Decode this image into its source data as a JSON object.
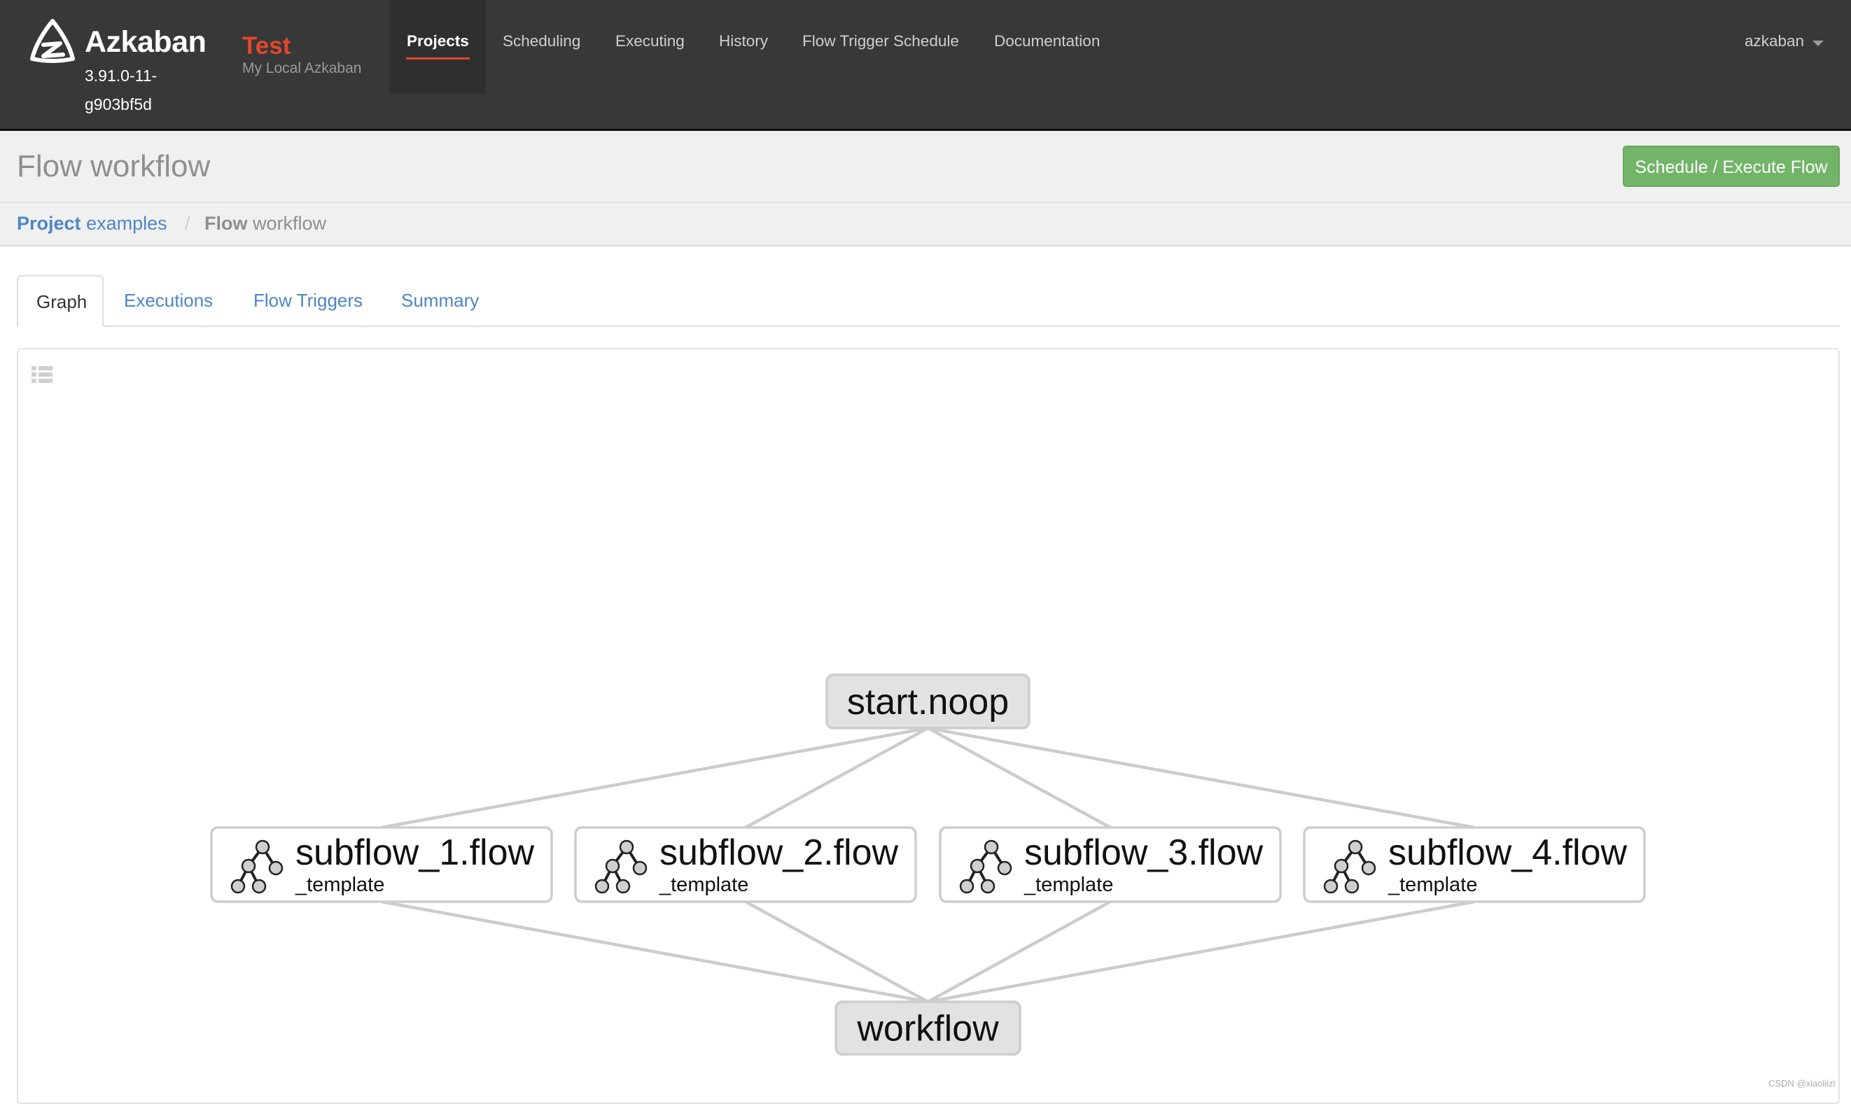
{
  "header": {
    "brand": "Azkaban",
    "version": "3.91.0-11-g903bf5d",
    "env_name": "Test",
    "env_description": "My Local Azkaban",
    "nav": [
      {
        "label": "Projects",
        "active": true
      },
      {
        "label": "Scheduling",
        "active": false
      },
      {
        "label": "Executing",
        "active": false
      },
      {
        "label": "History",
        "active": false
      },
      {
        "label": "Flow Trigger Schedule",
        "active": false
      },
      {
        "label": "Documentation",
        "active": false
      }
    ],
    "user": "azkaban",
    "accent_color": "#e0472b"
  },
  "title_bar": {
    "keyword": "Flow",
    "name": "workflow",
    "execute_button": "Schedule / Execute Flow"
  },
  "breadcrumb": {
    "project_keyword": "Project",
    "project_name": "examples",
    "separator": "/",
    "flow_keyword": "Flow",
    "flow_name": "workflow"
  },
  "tabs": [
    {
      "label": "Graph",
      "active": true
    },
    {
      "label": "Executions",
      "active": false
    },
    {
      "label": "Flow Triggers",
      "active": false
    },
    {
      "label": "Summary",
      "active": false
    }
  ],
  "graph": {
    "nodes": [
      {
        "id": "start",
        "label": "start.noop",
        "type": "job"
      },
      {
        "id": "s1",
        "label": "subflow_1.flow",
        "sublabel": "_template",
        "type": "flow"
      },
      {
        "id": "s2",
        "label": "subflow_2.flow",
        "sublabel": "_template",
        "type": "flow"
      },
      {
        "id": "s3",
        "label": "subflow_3.flow",
        "sublabel": "_template",
        "type": "flow"
      },
      {
        "id": "s4",
        "label": "subflow_4.flow",
        "sublabel": "_template",
        "type": "flow"
      },
      {
        "id": "end",
        "label": "workflow",
        "type": "job"
      }
    ],
    "edges": [
      [
        "start",
        "s1"
      ],
      [
        "start",
        "s2"
      ],
      [
        "start",
        "s3"
      ],
      [
        "start",
        "s4"
      ],
      [
        "s1",
        "end"
      ],
      [
        "s2",
        "end"
      ],
      [
        "s3",
        "end"
      ],
      [
        "s4",
        "end"
      ]
    ]
  },
  "watermark": "CSDN @xiaoliizi"
}
